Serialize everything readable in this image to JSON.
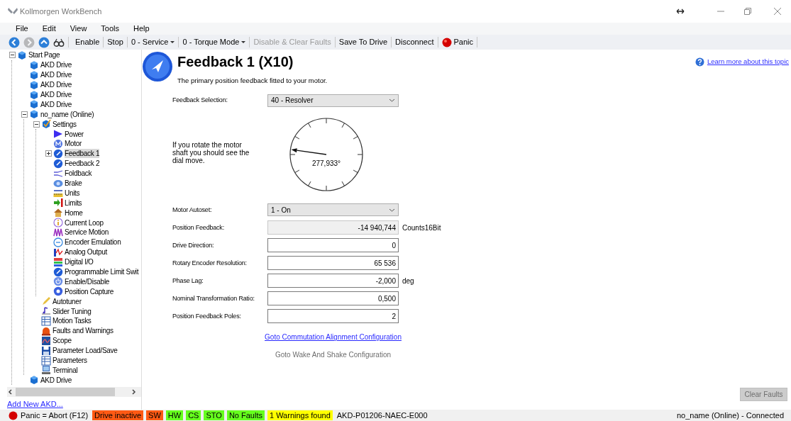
{
  "window": {
    "title": "Kollmorgen WorkBench"
  },
  "menu": [
    "File",
    "Edit",
    "View",
    "Tools",
    "Help"
  ],
  "toolbar": [
    {
      "kind": "back",
      "disabled": false
    },
    {
      "kind": "forward",
      "disabled": true
    },
    {
      "kind": "up",
      "disabled": false
    },
    {
      "kind": "glasses",
      "disabled": false
    },
    {
      "kind": "button",
      "label": "Enable",
      "disabled": false
    },
    {
      "kind": "button",
      "label": "Stop",
      "disabled": false
    },
    {
      "kind": "dropdown",
      "label": "0 - Service",
      "disabled": false
    },
    {
      "kind": "dropdown",
      "label": "0 - Torque Mode",
      "disabled": false
    },
    {
      "kind": "button",
      "label": "Disable & Clear Faults",
      "disabled": true
    },
    {
      "kind": "button",
      "label": "Save To Drive",
      "disabled": false
    },
    {
      "kind": "button",
      "label": "Disconnect",
      "disabled": false
    },
    {
      "kind": "panic",
      "label": "Panic",
      "disabled": false
    }
  ],
  "tree": [
    {
      "label": "Start Page",
      "kind": "drive",
      "expanded": true,
      "selected": false,
      "children": [
        {
          "label": "AKD Drive",
          "kind": "drive",
          "selected": false
        },
        {
          "label": "AKD Drive",
          "kind": "drive",
          "selected": false
        },
        {
          "label": "AKD Drive",
          "kind": "drive",
          "selected": false
        },
        {
          "label": "AKD Drive",
          "kind": "drive",
          "selected": false
        },
        {
          "label": "AKD Drive",
          "kind": "drive",
          "selected": false
        },
        {
          "label": "no_name (Online)",
          "kind": "drive",
          "expanded": true,
          "selected": false,
          "children": [
            {
              "label": "Settings",
              "kind": "settings",
              "expanded": true,
              "selected": false,
              "children": [
                {
                  "label": "Power",
                  "kind": "play",
                  "selected": false
                },
                {
                  "label": "Motor",
                  "kind": "motor",
                  "selected": false
                },
                {
                  "label": "Feedback 1",
                  "kind": "gauge",
                  "expanded": false,
                  "selected": true
                },
                {
                  "label": "Feedback 2",
                  "kind": "gauge",
                  "selected": false
                },
                {
                  "label": "Foldback",
                  "kind": "foldback",
                  "selected": false
                },
                {
                  "label": "Brake",
                  "kind": "brake",
                  "selected": false
                },
                {
                  "label": "Units",
                  "kind": "units",
                  "selected": false
                },
                {
                  "label": "Limits",
                  "kind": "limits",
                  "selected": false
                },
                {
                  "label": "Home",
                  "kind": "home",
                  "selected": false
                },
                {
                  "label": "Current Loop",
                  "kind": "info",
                  "selected": false
                },
                {
                  "label": "Service Motion",
                  "kind": "wave",
                  "selected": false
                },
                {
                  "label": "Encoder Emulation",
                  "kind": "encoder",
                  "selected": false
                },
                {
                  "label": "Analog Output",
                  "kind": "analog",
                  "selected": false
                },
                {
                  "label": "Digital I/O",
                  "kind": "digital",
                  "selected": false
                },
                {
                  "label": "Programmable Limit Swit",
                  "kind": "gauge",
                  "selected": false
                },
                {
                  "label": "Enable/Disable",
                  "kind": "power",
                  "selected": false
                },
                {
                  "label": "Position Capture",
                  "kind": "capture",
                  "selected": false
                }
              ]
            },
            {
              "label": "Autotuner",
              "kind": "pencil",
              "selected": false
            },
            {
              "label": "Slider Tuning",
              "kind": "slider",
              "selected": false
            },
            {
              "label": "Motion Tasks",
              "kind": "table",
              "selected": false
            },
            {
              "label": "Faults and Warnings",
              "kind": "fault",
              "selected": false
            },
            {
              "label": "Scope",
              "kind": "scope",
              "selected": false
            },
            {
              "label": "Parameter Load/Save",
              "kind": "save",
              "selected": false
            },
            {
              "label": "Parameters",
              "kind": "table",
              "selected": false
            },
            {
              "label": "Terminal",
              "kind": "terminal",
              "selected": false
            }
          ]
        },
        {
          "label": "AKD Drive",
          "kind": "drive",
          "selected": false
        }
      ]
    }
  ],
  "add_link": "Add New AKD...",
  "page": {
    "title": "Feedback 1 (X10)",
    "subtitle": "The primary position feedback fitted to your motor.",
    "help_link": "Learn more about this topic"
  },
  "feedback_selection": {
    "label": "Feedback Selection:",
    "value": "40 - Resolver"
  },
  "dial": {
    "hint": "If you rotate the motor shaft you should see the dial move.",
    "reading": "277,933°"
  },
  "form": [
    {
      "label": "Motor Autoset:",
      "kind": "select",
      "value": "1 - On"
    },
    {
      "label": "Position Feedback:",
      "kind": "field",
      "value": "-14 940,744",
      "readonly": true,
      "unit": "Counts16Bit"
    },
    {
      "label": "Drive Direction:",
      "kind": "field",
      "value": "0",
      "readonly": false
    },
    {
      "label": "Rotary Encoder Resolution:",
      "kind": "field",
      "value": "65 536",
      "readonly": false
    },
    {
      "label": "Phase Lag:",
      "kind": "field",
      "value": "-2,000",
      "readonly": false,
      "unit": "deg"
    },
    {
      "label": "Nominal Transformation Ratio:",
      "kind": "field",
      "value": "0,500",
      "readonly": false
    },
    {
      "label": "Position Feedback Poles:",
      "kind": "field",
      "value": "2",
      "readonly": false
    }
  ],
  "links": [
    {
      "text": "Goto Commutation Alignment Configuration",
      "kind": "link"
    },
    {
      "text": "Goto Wake And Shake Configuration",
      "kind": "text"
    }
  ],
  "clear_faults": {
    "label": "Clear Faults",
    "disabled": true
  },
  "status_bar": {
    "panic": "Panic = Abort (F12)",
    "badges": [
      {
        "text": "Drive inactive",
        "color": "#ff5a14"
      },
      {
        "text": "SW",
        "color": "#ff5a14"
      },
      {
        "text": "HW",
        "color": "#66ff1e"
      },
      {
        "text": "CS",
        "color": "#66ff1e"
      },
      {
        "text": "STO",
        "color": "#66ff1e"
      },
      {
        "text": "No Faults",
        "color": "#66ff1e"
      },
      {
        "text": "1  Warnings found",
        "color": "#ffff00"
      }
    ],
    "device": "AKD-P01206-NAEC-E000",
    "connection": "no_name (Online) - Connected"
  }
}
